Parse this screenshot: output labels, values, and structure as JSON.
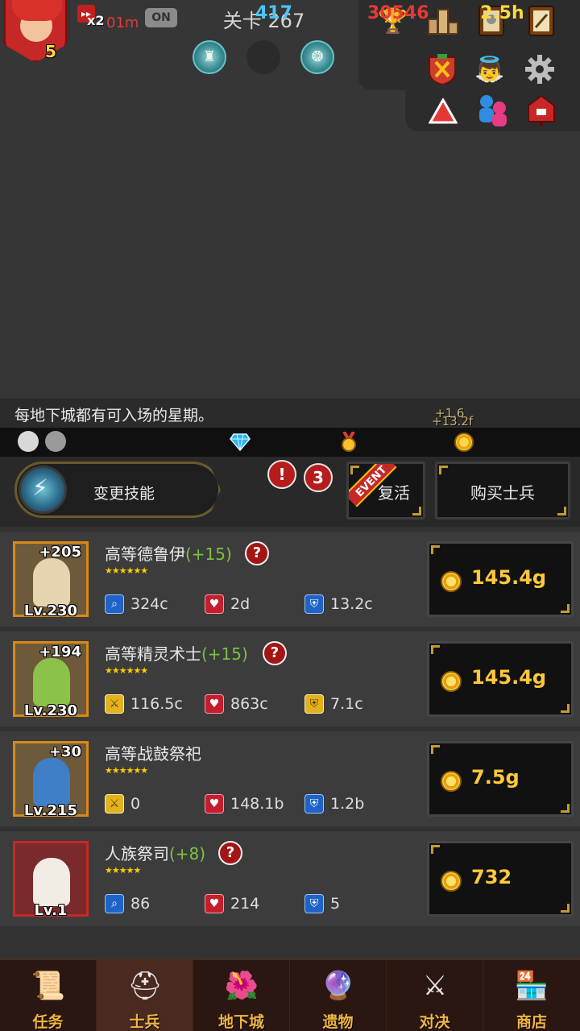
{
  "header": {
    "player_level": "5",
    "speed_multiplier": "x2",
    "speed_time": "01m",
    "toggle_label": "ON",
    "stage_label": "关卡 267"
  },
  "menu_icons": [
    "trophy-icon",
    "ranking-icon",
    "armor-book-icon",
    "scroll-book-icon",
    "shield-crest-icon",
    "angel-icon",
    "gear-icon",
    "warning-triangle-icon",
    "friends-icon",
    "mailbox-icon"
  ],
  "tip": {
    "text": "每地下城都有可入场的星期。",
    "float_1": "+1.6",
    "float_2": "+13.2f"
  },
  "resources": {
    "gems": "417",
    "medals": "30546",
    "gold_rate": "2.5h",
    "gem_color": "#4fc3f7",
    "medal_color": "#e53935",
    "gold_color": "#ffd740"
  },
  "actions": {
    "skill_label": "变更技能",
    "alert_badge": "!",
    "count_badge": "3",
    "event_tag": "EVENT",
    "revive_label": "复活",
    "buy_soldier_label": "购买士兵"
  },
  "units": [
    {
      "name": "高等德鲁伊",
      "bonus": "(+15)",
      "has_help": true,
      "plus": "+205",
      "level": "Lv.230",
      "stars": "★★★★★★",
      "stat1_icon": "magnifier-icon",
      "stat1": "324c",
      "stat2": "2d",
      "stat3": "13.2c",
      "price": "145.4g"
    },
    {
      "name": "高等精灵术士",
      "bonus": "(+15)",
      "has_help": true,
      "plus": "+194",
      "level": "Lv.230",
      "stars": "★★★★★★",
      "stat1_icon": "sword-icon",
      "stat1": "116.5c",
      "stat2": "863c",
      "stat3": "7.1c",
      "price": "145.4g"
    },
    {
      "name": "高等战鼓祭祀",
      "bonus": "",
      "has_help": false,
      "plus": "+30",
      "level": "Lv.215",
      "stars": "★★★★★★",
      "stat1_icon": "sword-icon",
      "stat1": "0",
      "stat2": "148.1b",
      "stat3": "1.2b",
      "price": "7.5g"
    },
    {
      "name": "人族祭司",
      "bonus": "(+8)",
      "has_help": true,
      "plus": "",
      "level": "Lv.1",
      "stars": "★★★★★",
      "stat1_icon": "magnifier-icon",
      "stat1": "86",
      "stat2": "214",
      "stat3": "5",
      "price": "732"
    }
  ],
  "nav": {
    "tabs": [
      "任务",
      "士兵",
      "地下城",
      "遗物",
      "对决",
      "商店"
    ],
    "active": "士兵"
  }
}
